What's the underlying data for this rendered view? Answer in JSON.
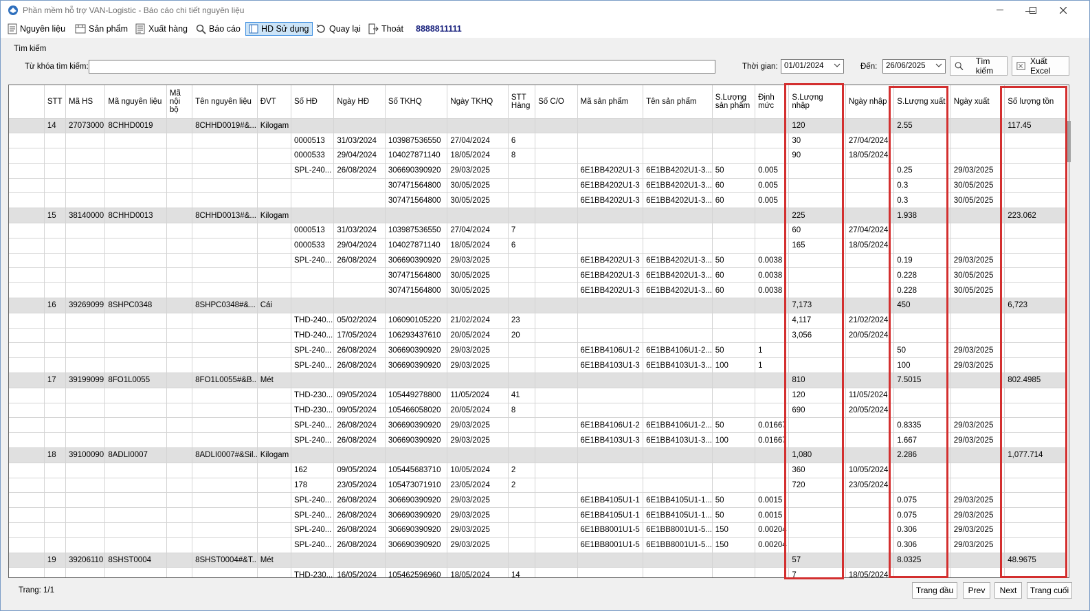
{
  "window": {
    "title": "Phần mềm hỗ trợ VAN-Logistic - Báo cáo chi tiết nguyên liệu"
  },
  "menu": {
    "items": [
      "Nguyên liệu",
      "Sản phẩm",
      "Xuất hàng",
      "Báo cáo",
      "HD Sử dụng",
      "Quay lại",
      "Thoát"
    ],
    "phone": "8888811111"
  },
  "search": {
    "group_label": "Tìm kiếm",
    "keyword_label": "Từ khóa tìm kiếm:",
    "keyword_value": "",
    "time_label": "Thời gian:",
    "from_date": "01/01/2024",
    "to_label": "Đến:",
    "to_date": "26/06/2025",
    "search_button": "Tìm kiếm",
    "export_button": "Xuất Excel"
  },
  "table": {
    "columns": [
      "",
      "STT",
      "Mã HS",
      "Mã nguyên liệu",
      "Mã nội bộ",
      "Tên nguyên liệu",
      "ĐVT",
      "Số HĐ",
      "Ngày HĐ",
      "Số TKHQ",
      "Ngày TKHQ",
      "STT Hàng",
      "Số C/O",
      "Mã sản phẩm",
      "Tên sản phẩm",
      "S.Lượng sản phẩm",
      "Định mức",
      "S.Lượng nhập",
      "Ngày nhập",
      "S.Lượng xuất",
      "Ngày xuất",
      "Số lượng tồn"
    ],
    "rows": [
      {
        "g": 1,
        "c": [
          "",
          "14",
          "27073000",
          "8CHHD0019",
          "",
          "8CHHD0019#&...",
          "Kilogam",
          "",
          "",
          "",
          "",
          "",
          "",
          "",
          "",
          "",
          "",
          "120",
          "",
          "2.55",
          "",
          "117.45"
        ]
      },
      {
        "g": 0,
        "c": [
          "",
          "",
          "",
          "",
          "",
          "",
          "",
          "0000513",
          "31/03/2024",
          "103987536550",
          "27/04/2024",
          "6",
          "",
          "",
          "",
          "",
          "",
          "30",
          "27/04/2024",
          "",
          "",
          ""
        ]
      },
      {
        "g": 0,
        "c": [
          "",
          "",
          "",
          "",
          "",
          "",
          "",
          "0000533",
          "29/04/2024",
          "104027871140",
          "18/05/2024",
          "8",
          "",
          "",
          "",
          "",
          "",
          "90",
          "18/05/2024",
          "",
          "",
          ""
        ]
      },
      {
        "g": 0,
        "c": [
          "",
          "",
          "",
          "",
          "",
          "",
          "",
          "SPL-240...",
          "26/08/2024",
          "306690390920",
          "29/03/2025",
          "",
          "",
          "6E1BB4202U1-3",
          "6E1BB4202U1-3...",
          "50",
          "0.005",
          "",
          "",
          "0.25",
          "29/03/2025",
          ""
        ]
      },
      {
        "g": 0,
        "c": [
          "",
          "",
          "",
          "",
          "",
          "",
          "",
          "",
          "",
          "307471564800",
          "30/05/2025",
          "",
          "",
          "6E1BB4202U1-3",
          "6E1BB4202U1-3...",
          "60",
          "0.005",
          "",
          "",
          "0.3",
          "30/05/2025",
          ""
        ]
      },
      {
        "g": 0,
        "c": [
          "",
          "",
          "",
          "",
          "",
          "",
          "",
          "",
          "",
          "307471564800",
          "30/05/2025",
          "",
          "",
          "6E1BB4202U1-3",
          "6E1BB4202U1-3...",
          "60",
          "0.005",
          "",
          "",
          "0.3",
          "30/05/2025",
          ""
        ]
      },
      {
        "g": 1,
        "c": [
          "",
          "15",
          "38140000",
          "8CHHD0013",
          "",
          "8CHHD0013#&...",
          "Kilogam",
          "",
          "",
          "",
          "",
          "",
          "",
          "",
          "",
          "",
          "",
          "225",
          "",
          "1.938",
          "",
          "223.062"
        ]
      },
      {
        "g": 0,
        "c": [
          "",
          "",
          "",
          "",
          "",
          "",
          "",
          "0000513",
          "31/03/2024",
          "103987536550",
          "27/04/2024",
          "7",
          "",
          "",
          "",
          "",
          "",
          "60",
          "27/04/2024",
          "",
          "",
          ""
        ]
      },
      {
        "g": 0,
        "c": [
          "",
          "",
          "",
          "",
          "",
          "",
          "",
          "0000533",
          "29/04/2024",
          "104027871140",
          "18/05/2024",
          "6",
          "",
          "",
          "",
          "",
          "",
          "165",
          "18/05/2024",
          "",
          "",
          ""
        ]
      },
      {
        "g": 0,
        "c": [
          "",
          "",
          "",
          "",
          "",
          "",
          "",
          "SPL-240...",
          "26/08/2024",
          "306690390920",
          "29/03/2025",
          "",
          "",
          "6E1BB4202U1-3",
          "6E1BB4202U1-3...",
          "50",
          "0.0038",
          "",
          "",
          "0.19",
          "29/03/2025",
          ""
        ]
      },
      {
        "g": 0,
        "c": [
          "",
          "",
          "",
          "",
          "",
          "",
          "",
          "",
          "",
          "307471564800",
          "30/05/2025",
          "",
          "",
          "6E1BB4202U1-3",
          "6E1BB4202U1-3...",
          "60",
          "0.0038",
          "",
          "",
          "0.228",
          "30/05/2025",
          ""
        ]
      },
      {
        "g": 0,
        "c": [
          "",
          "",
          "",
          "",
          "",
          "",
          "",
          "",
          "",
          "307471564800",
          "30/05/2025",
          "",
          "",
          "6E1BB4202U1-3",
          "6E1BB4202U1-3...",
          "60",
          "0.0038",
          "",
          "",
          "0.228",
          "30/05/2025",
          ""
        ]
      },
      {
        "g": 1,
        "c": [
          "",
          "16",
          "39269099",
          "8SHPC0348",
          "",
          "8SHPC0348#&...",
          "Cái",
          "",
          "",
          "",
          "",
          "",
          "",
          "",
          "",
          "",
          "",
          "7,173",
          "",
          "450",
          "",
          "6,723"
        ]
      },
      {
        "g": 0,
        "c": [
          "",
          "",
          "",
          "",
          "",
          "",
          "",
          "THD-240...",
          "05/02/2024",
          "106090105220",
          "21/02/2024",
          "23",
          "",
          "",
          "",
          "",
          "",
          "4,117",
          "21/02/2024",
          "",
          "",
          ""
        ]
      },
      {
        "g": 0,
        "c": [
          "",
          "",
          "",
          "",
          "",
          "",
          "",
          "THD-240...",
          "17/05/2024",
          "106293437610",
          "20/05/2024",
          "20",
          "",
          "",
          "",
          "",
          "",
          "3,056",
          "20/05/2024",
          "",
          "",
          ""
        ]
      },
      {
        "g": 0,
        "c": [
          "",
          "",
          "",
          "",
          "",
          "",
          "",
          "SPL-240...",
          "26/08/2024",
          "306690390920",
          "29/03/2025",
          "",
          "",
          "6E1BB4106U1-2",
          "6E1BB4106U1-2...",
          "50",
          "1",
          "",
          "",
          "50",
          "29/03/2025",
          ""
        ]
      },
      {
        "g": 0,
        "c": [
          "",
          "",
          "",
          "",
          "",
          "",
          "",
          "SPL-240...",
          "26/08/2024",
          "306690390920",
          "29/03/2025",
          "",
          "",
          "6E1BB4103U1-3",
          "6E1BB4103U1-3...",
          "100",
          "1",
          "",
          "",
          "100",
          "29/03/2025",
          ""
        ]
      },
      {
        "g": 1,
        "c": [
          "",
          "17",
          "39199099",
          "8FO1L0055",
          "",
          "8FO1L0055#&B...",
          "Mét",
          "",
          "",
          "",
          "",
          "",
          "",
          "",
          "",
          "",
          "",
          "810",
          "",
          "7.5015",
          "",
          "802.4985"
        ]
      },
      {
        "g": 0,
        "c": [
          "",
          "",
          "",
          "",
          "",
          "",
          "",
          "THD-230...",
          "09/05/2024",
          "105449278800",
          "11/05/2024",
          "41",
          "",
          "",
          "",
          "",
          "",
          "120",
          "11/05/2024",
          "",
          "",
          ""
        ]
      },
      {
        "g": 0,
        "c": [
          "",
          "",
          "",
          "",
          "",
          "",
          "",
          "THD-230...",
          "09/05/2024",
          "105466058020",
          "20/05/2024",
          "8",
          "",
          "",
          "",
          "",
          "",
          "690",
          "20/05/2024",
          "",
          "",
          ""
        ]
      },
      {
        "g": 0,
        "c": [
          "",
          "",
          "",
          "",
          "",
          "",
          "",
          "SPL-240...",
          "26/08/2024",
          "306690390920",
          "29/03/2025",
          "",
          "",
          "6E1BB4106U1-2",
          "6E1BB4106U1-2...",
          "50",
          "0.01667",
          "",
          "",
          "0.8335",
          "29/03/2025",
          ""
        ]
      },
      {
        "g": 0,
        "c": [
          "",
          "",
          "",
          "",
          "",
          "",
          "",
          "SPL-240...",
          "26/08/2024",
          "306690390920",
          "29/03/2025",
          "",
          "",
          "6E1BB4103U1-3",
          "6E1BB4103U1-3...",
          "100",
          "0.01667",
          "",
          "",
          "1.667",
          "29/03/2025",
          ""
        ]
      },
      {
        "g": 1,
        "c": [
          "",
          "18",
          "39100090",
          "8ADLI0007",
          "",
          "8ADLI0007#&Sil...",
          "Kilogam",
          "",
          "",
          "",
          "",
          "",
          "",
          "",
          "",
          "",
          "",
          "1,080",
          "",
          "2.286",
          "",
          "1,077.714"
        ]
      },
      {
        "g": 0,
        "c": [
          "",
          "",
          "",
          "",
          "",
          "",
          "",
          "162",
          "09/05/2024",
          "105445683710",
          "10/05/2024",
          "2",
          "",
          "",
          "",
          "",
          "",
          "360",
          "10/05/2024",
          "",
          "",
          ""
        ]
      },
      {
        "g": 0,
        "c": [
          "",
          "",
          "",
          "",
          "",
          "",
          "",
          "178",
          "23/05/2024",
          "105473071910",
          "23/05/2024",
          "2",
          "",
          "",
          "",
          "",
          "",
          "720",
          "23/05/2024",
          "",
          "",
          ""
        ]
      },
      {
        "g": 0,
        "c": [
          "",
          "",
          "",
          "",
          "",
          "",
          "",
          "SPL-240...",
          "26/08/2024",
          "306690390920",
          "29/03/2025",
          "",
          "",
          "6E1BB4105U1-1",
          "6E1BB4105U1-1...",
          "50",
          "0.0015",
          "",
          "",
          "0.075",
          "29/03/2025",
          ""
        ]
      },
      {
        "g": 0,
        "c": [
          "",
          "",
          "",
          "",
          "",
          "",
          "",
          "SPL-240...",
          "26/08/2024",
          "306690390920",
          "29/03/2025",
          "",
          "",
          "6E1BB4105U1-1",
          "6E1BB4105U1-1...",
          "50",
          "0.0015",
          "",
          "",
          "0.075",
          "29/03/2025",
          ""
        ]
      },
      {
        "g": 0,
        "c": [
          "",
          "",
          "",
          "",
          "",
          "",
          "",
          "SPL-240...",
          "26/08/2024",
          "306690390920",
          "29/03/2025",
          "",
          "",
          "6E1BB8001U1-5",
          "6E1BB8001U1-5...",
          "150",
          "0.00204",
          "",
          "",
          "0.306",
          "29/03/2025",
          ""
        ]
      },
      {
        "g": 0,
        "c": [
          "",
          "",
          "",
          "",
          "",
          "",
          "",
          "SPL-240...",
          "26/08/2024",
          "306690390920",
          "29/03/2025",
          "",
          "",
          "6E1BB8001U1-5",
          "6E1BB8001U1-5...",
          "150",
          "0.00204",
          "",
          "",
          "0.306",
          "29/03/2025",
          ""
        ]
      },
      {
        "g": 1,
        "c": [
          "",
          "19",
          "39206110",
          "8SHST0004",
          "",
          "8SHST0004#&T...",
          "Mét",
          "",
          "",
          "",
          "",
          "",
          "",
          "",
          "",
          "",
          "",
          "57",
          "",
          "8.0325",
          "",
          "48.9675"
        ]
      },
      {
        "g": 0,
        "c": [
          "",
          "",
          "",
          "",
          "",
          "",
          "",
          "THD-230...",
          "16/05/2024",
          "105462596960",
          "18/05/2024",
          "14",
          "",
          "",
          "",
          "",
          "",
          "7",
          "18/05/2024",
          "",
          "",
          ""
        ]
      }
    ]
  },
  "footer": {
    "page_info": "Trang: 1/1",
    "first": "Trang đầu",
    "prev": "Prev",
    "next": "Next",
    "last": "Trang cuối"
  },
  "colors": {
    "highlight": "#d32f2f",
    "group_row": "#e0e0e0",
    "active_menu": "#cce4f7"
  }
}
